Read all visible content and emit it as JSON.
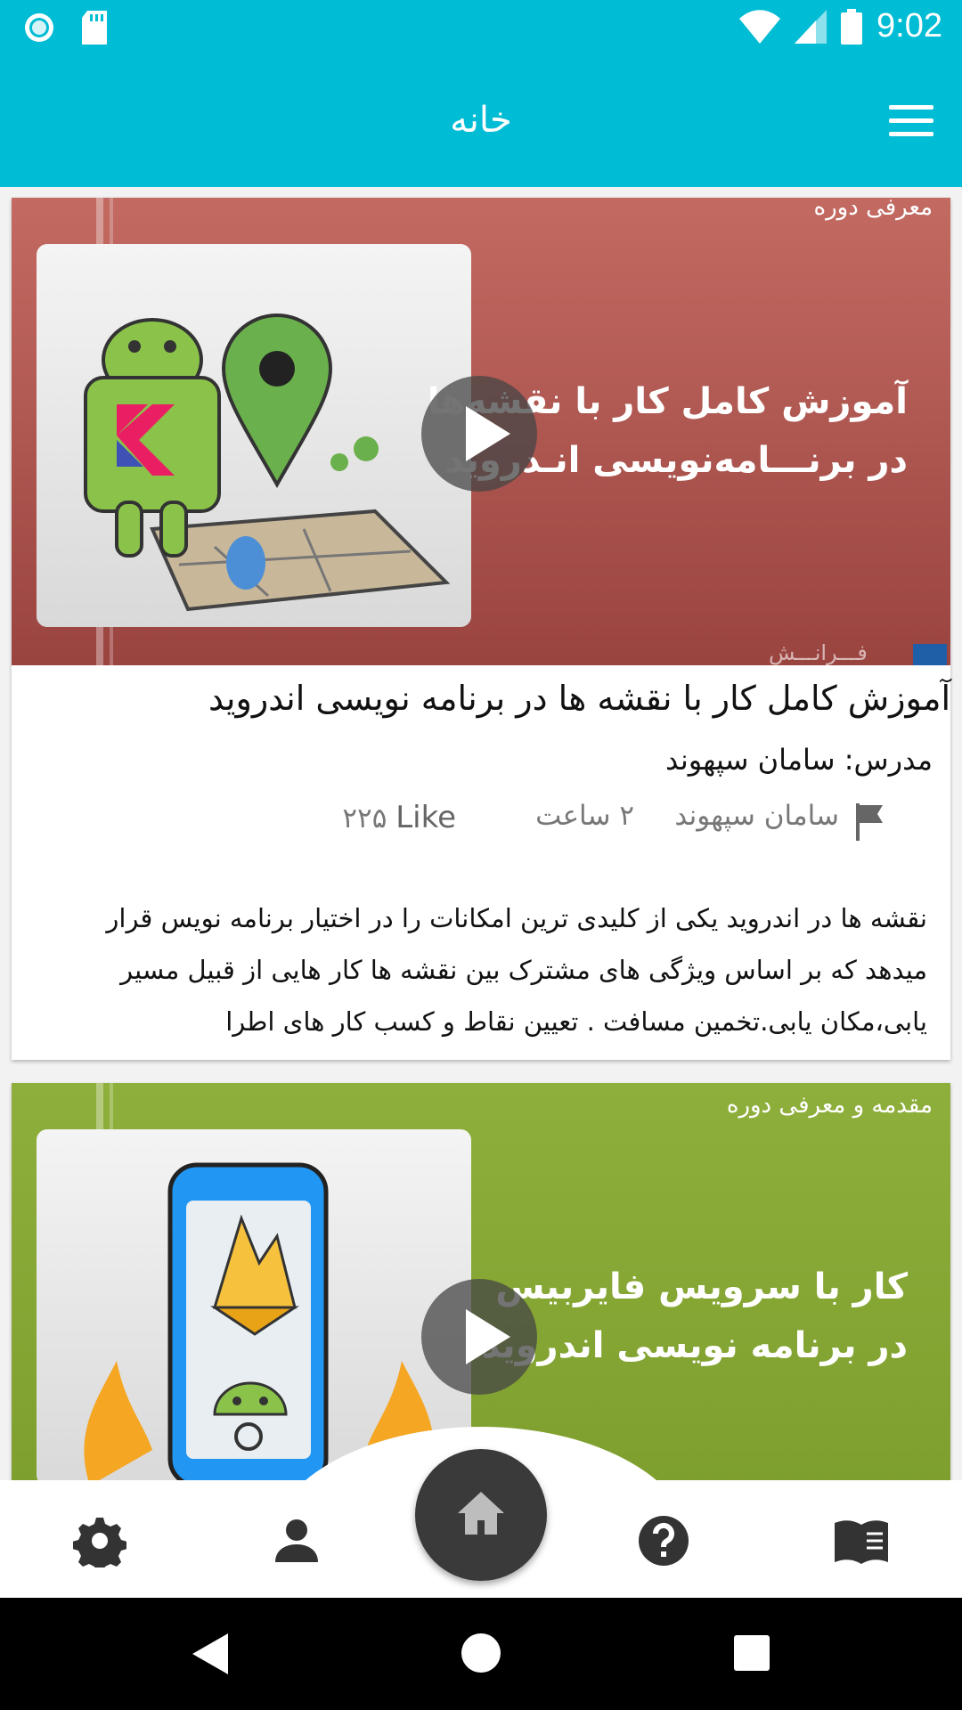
{
  "status_bar": {
    "time": "9:02",
    "icons": [
      "notification-circle-icon",
      "sd-card-icon",
      "wifi-icon",
      "signal-icon",
      "battery-icon"
    ]
  },
  "app_bar": {
    "title": "خانه",
    "menu_icon": "hamburger-menu-icon"
  },
  "courses": [
    {
      "thumbnail_tag": "معرفی دوره",
      "thumbnail_line1": "آموزش کامل کار با نقشه‌ها",
      "thumbnail_line2": "در برنـــامه‌نویسی انـدروید",
      "watermark": "فـــرانـــش",
      "title": "آموزش کامل کار با نقشه ها در برنامه نویسی اندروید",
      "teacher": "مدرس: سامان سپهوند",
      "author": "سامان سپهوند",
      "duration": "۲ ساعت",
      "likes_count": "۲۲۵",
      "likes_label": "Like",
      "description": "نقشه ها در اندروید یکی از کلیدی ترین امکانات را در اختیار برنامه نویس قرار میدهد که بر اساس ویژگی های مشترک بین نقشه ها کار هایی از قبیل مسیر یابی،مکان یابی.تخمین مسافت . تعیین نقاط و کسب کار های اطرا"
    },
    {
      "thumbnail_tag": "مقدمه و معرفی دوره",
      "thumbnail_line1": "کار با سرویس فایربیس",
      "thumbnail_line2": "در برنامه نویسی اندروید"
    }
  ],
  "bottom_nav": {
    "items": [
      "gear-icon",
      "person-icon",
      "home-icon",
      "help-icon",
      "book-icon"
    ]
  },
  "colors": {
    "primary": "#00bcd4",
    "fab": "#3a3a3a",
    "card1_thumb": "#b85a55",
    "card2_thumb": "#8aa936"
  }
}
